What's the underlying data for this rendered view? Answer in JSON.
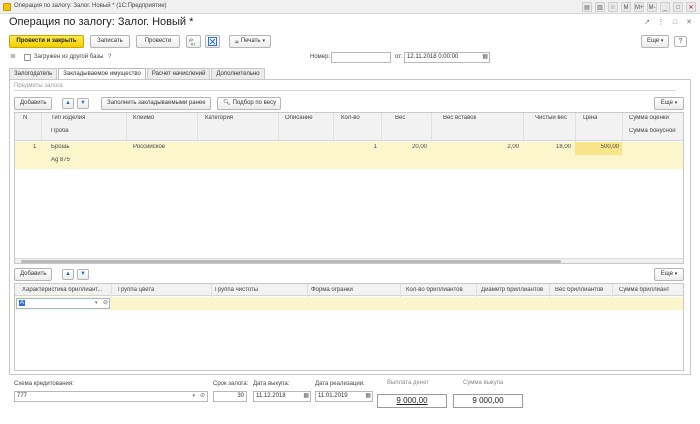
{
  "window": {
    "title": "Операция по залогу: Залог. Новый * (1С:Предприятие)",
    "buttons": [
      "▤",
      "▥",
      "☆",
      "M",
      "M+",
      "M-",
      "_",
      "□",
      "✕"
    ]
  },
  "header": {
    "title": "Операция по залогу: Залог. Новый *",
    "icons": [
      "↗",
      "⋮",
      "□",
      "✕"
    ]
  },
  "toolbar": {
    "post_and_close": "Провести и закрыть",
    "save": "Записать",
    "post": "Провести",
    "print": "Печать",
    "more": "Еще"
  },
  "form": {
    "loaded_from_other_base": "Загружен из другой базы",
    "help": "?",
    "number_label": "Номер:",
    "number_value": "",
    "date_label": "от:",
    "date_value": "12.11.2018  0:00:00"
  },
  "tabs": [
    {
      "label": "Залогодатель"
    },
    {
      "label": "Закладываемое имущество"
    },
    {
      "label": "Расчет начислений"
    },
    {
      "label": "Дополнительно"
    }
  ],
  "items_section": {
    "caption": "Предметы залога",
    "add": "Добавить",
    "fill": "Заполнить закладываемыми ранее",
    "select_by_weight": "Подбор по весу",
    "more": "Еще",
    "columns_top": [
      "N",
      "Тип изделия",
      "Клеймо",
      "Категория",
      "Описание",
      "Кол-во",
      "Вес",
      "Вес вставок",
      "Чистый вес",
      "Цена",
      "Сумма оценки"
    ],
    "columns_bottom": [
      "Проба",
      "Сумма бонусной"
    ],
    "rows": [
      {
        "n": "1",
        "type": "Брошь",
        "hallmark": "Российское",
        "category": "",
        "description": "",
        "qty": "1",
        "weight": "20,00",
        "inserts_weight": "2,00",
        "net_weight": "18,00",
        "price": "500,00",
        "appraisal": "",
        "probe": "Ag 875"
      }
    ]
  },
  "diamonds_section": {
    "add": "Добавить",
    "more": "Еще",
    "columns": [
      "Характеристика бриллиант...",
      "Группа цвета",
      "Группа чистоты",
      "Форма огранки",
      "Кол-во бриллиантов",
      "Диаметр бриллиантов",
      "Вес бриллиантов",
      "Сумма бриллиант"
    ],
    "row_value": "А"
  },
  "footer": {
    "scheme_label": "Схема кредитования:",
    "scheme_value": "777",
    "term_label": "Срок залога:",
    "term_value": "30",
    "redeem_date_label": "Дата выкупа:",
    "redeem_date_value": "11.12.2018",
    "sale_date_label": "Дата реализации:",
    "sale_date_value": "11.01.2019",
    "payout_label": "Выплата денег",
    "payout_value": "9 000,00",
    "redeem_sum_label": "Сумма выкупа",
    "redeem_sum_value": "9 000,00"
  },
  "colors": {
    "primary_button": "#f3cf00",
    "selected_row": "#fcf6cd",
    "arrows": "#2a6fd6"
  }
}
